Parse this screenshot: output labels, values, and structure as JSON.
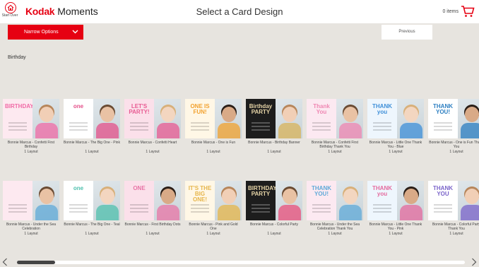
{
  "header": {
    "start_over_label": "Start Over",
    "logo_brand": "Kodak",
    "logo_product": "Moments",
    "title": "Select a Card Design",
    "cart_count": "0 items",
    "icons": {
      "start_over": "house-icon",
      "cart": "cart-icon"
    }
  },
  "toolbar": {
    "narrow_label": "Narrow Options",
    "previous_label": "Previous"
  },
  "section_title": "Birthday",
  "colors": {
    "accent": "#e60012",
    "background": "#e7e4df",
    "header": "#ffffff"
  },
  "row1": [
    {
      "name": "Bonnie Marcus - Confetti First Birthday",
      "layouts": "1 Layout",
      "headline": "BIRTHDAY",
      "accent": "#f06aa6"
    },
    {
      "name": "Bonnie Marcus - The Big One - Pink",
      "layouts": "1 Layout",
      "headline": "one",
      "accent": "#e4508a"
    },
    {
      "name": "Bonnie Marcus - Confetti Heart",
      "layouts": "1 Layout",
      "headline": "LET'S PARTY!",
      "accent": "#e85a92"
    },
    {
      "name": "Bonnie Marcus - One is Fun",
      "layouts": "1 Layout",
      "headline": "ONE IS FUN!",
      "accent": "#f2a12e"
    },
    {
      "name": "Bonnie Marcus - Birthday Banner",
      "layouts": "1 Layout",
      "headline": "Birthday PARTY",
      "accent": "#d8b35a"
    },
    {
      "name": "Bonnie Marcus - Confetti First Birthday Thank You",
      "layouts": "1 Layout",
      "headline": "Thank You",
      "accent": "#ef86b2"
    },
    {
      "name": "Bonnie Marcus - Little One Thank You - Blue",
      "layouts": "1 Layout",
      "headline": "THANK you",
      "accent": "#3e8fd8"
    },
    {
      "name": "Bonnie Marcus - One is Fun Thank You",
      "layouts": "1 Layout",
      "headline": "THANK YOU!",
      "accent": "#2b7ec1"
    }
  ],
  "row2": [
    {
      "name": "Bonnie Marcus - Under the Sea Celebration",
      "layouts": "1 Layout",
      "headline": "",
      "accent": "#5fa9d8"
    },
    {
      "name": "Bonnie Marcus - The Big One - Teal",
      "layouts": "1 Layout",
      "headline": "one",
      "accent": "#4fc0ad"
    },
    {
      "name": "Bonnie Marcus - First Birthday Dots",
      "layouts": "1 Layout",
      "headline": "ONE",
      "accent": "#e874a6"
    },
    {
      "name": "Bonnie Marcus - Pink and Gold One",
      "layouts": "1 Layout",
      "headline": "IT'S THE BIG ONE!",
      "accent": "#e6b54a"
    },
    {
      "name": "Bonnie Marcus - Colorful Party",
      "layouts": "1 Layout",
      "headline": "BIRTHDAY PARTY",
      "accent": "#ea4f7b"
    },
    {
      "name": "Bonnie Marcus - Under the Sea Celebration Thank You",
      "layouts": "1 Layout",
      "headline": "THANK YOU!",
      "accent": "#5fa9d8"
    },
    {
      "name": "Bonnie Marcus - Little One Thank You - Pink",
      "layouts": "1 Layout",
      "headline": "THANK you",
      "accent": "#e46a9e"
    },
    {
      "name": "Bonnie Marcus - Colorful Party Thank You",
      "layouts": "1 Layout",
      "headline": "THANK YOU",
      "accent": "#7a63c9"
    }
  ],
  "scroll": {
    "left_icon": "chevron-left-icon",
    "right_icon": "chevron-right-icon",
    "position": 0
  }
}
